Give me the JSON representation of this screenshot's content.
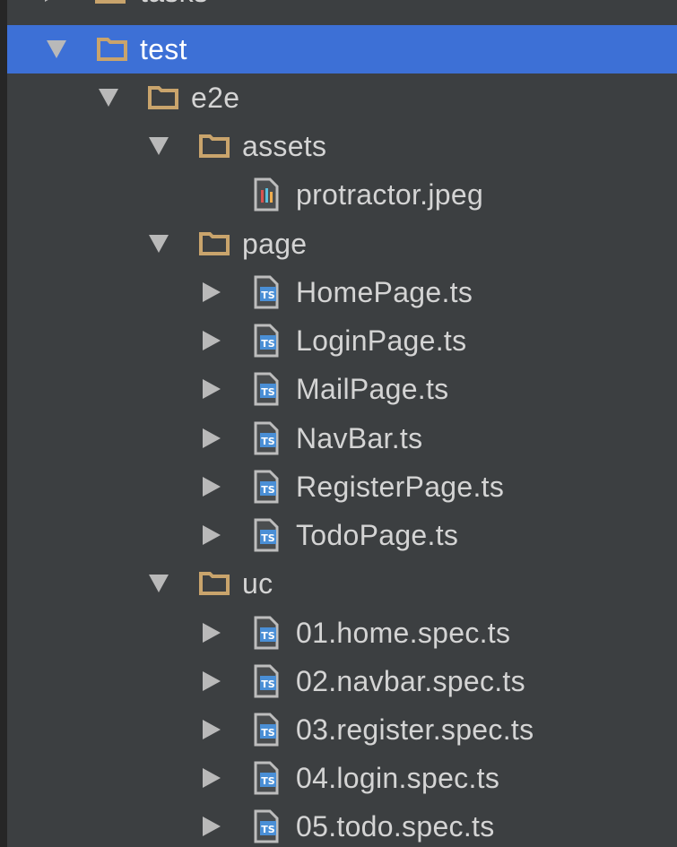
{
  "project_tree": {
    "partial_top_label": "tasks",
    "items": [
      {
        "label": "test",
        "type": "folder",
        "expanded": true,
        "selected": true
      },
      {
        "label": "e2e",
        "type": "folder",
        "expanded": true
      },
      {
        "label": "assets",
        "type": "folder",
        "expanded": true
      },
      {
        "label": "protractor.jpeg",
        "type": "image-file"
      },
      {
        "label": "page",
        "type": "folder",
        "expanded": true
      },
      {
        "label": "HomePage.ts",
        "type": "ts-file"
      },
      {
        "label": "LoginPage.ts",
        "type": "ts-file"
      },
      {
        "label": "MailPage.ts",
        "type": "ts-file"
      },
      {
        "label": "NavBar.ts",
        "type": "ts-file"
      },
      {
        "label": "RegisterPage.ts",
        "type": "ts-file"
      },
      {
        "label": "TodoPage.ts",
        "type": "ts-file"
      },
      {
        "label": "uc",
        "type": "folder",
        "expanded": true
      },
      {
        "label": "01.home.spec.ts",
        "type": "ts-file"
      },
      {
        "label": "02.navbar.spec.ts",
        "type": "ts-file"
      },
      {
        "label": "03.register.spec.ts",
        "type": "ts-file"
      },
      {
        "label": "04.login.spec.ts",
        "type": "ts-file"
      },
      {
        "label": "05.todo.spec.ts",
        "type": "ts-file"
      }
    ],
    "ts_badge": "TS"
  },
  "colors": {
    "background": "#3c3f41",
    "selection": "#3d70d6",
    "folder": "#c9a46c",
    "text": "#d4d4d4",
    "ts_icon": "#4a8fd6"
  },
  "icons": {
    "folder": "folder-icon",
    "ts_file": "typescript-file-icon",
    "image_file": "image-file-icon",
    "expand": "chevron-down-icon",
    "collapse": "chevron-right-icon"
  }
}
